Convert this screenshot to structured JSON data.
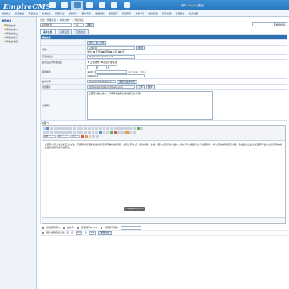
{
  "app": {
    "logo": "EmpireCMS",
    "top_icons": [
      "系统",
      "栏目",
      "信息",
      "模板",
      "用户",
      "其他",
      "插件"
    ],
    "active_top_icon": 2,
    "user_label": "用户:",
    "user_name": "admin",
    "logout": "[退出]"
  },
  "nav": [
    "增加信息",
    "管理信息",
    "审核信息",
    "签发信息",
    "管理评论",
    "更新碎片",
    "更新专题",
    "数据更新",
    "更新缓存",
    "管理附件",
    "发布字段",
    "类型管理",
    "标签管理",
    "远程发布",
    "站点地图"
  ],
  "sidebar": {
    "root": "管理信息",
    "items": [
      "导航分类",
      "导航分类一",
      "导航分类二",
      "导航分类三",
      "导航分类四"
    ]
  },
  "crumb": {
    "prefix": "位置：",
    "parts": [
      "管理信息",
      "导航分类一"
    ],
    "sep": " > ",
    "tail": "> 增加信息"
  },
  "toolbar": {
    "column_select": "请选择栏目",
    "rows_select": "一般",
    "go_button": "添加",
    "search_placeholder": "",
    "search_button": "搜索信息"
  },
  "tabs": [
    "基本信息",
    "选项设置",
    "设置信息"
  ],
  "form": {
    "header": "增加信息",
    "submit_label": "提交",
    "reset_label": "重置",
    "title_label": "标题(*)",
    "title_value": "标题名称",
    "check_btn": "检测",
    "attr_label": "属性",
    "attr_opts": [
      "置顶",
      "推荐",
      "头条",
      "幻灯"
    ],
    "source_label": "来源(链接)",
    "source_value": "http://www.phome.net/",
    "outlink_label": "是否直接为外部链接",
    "outlink_opts": [
      "正常发布",
      "直接外部链接"
    ],
    "sort_label": "特殊属性",
    "keywords_label": "关键字",
    "keywords_hint": "(多个请用\",\"隔开)",
    "titlepic_label": "外部链接",
    "pubtime_label": "发布时间",
    "pubtime_value": "2024-04-02 12:08:14",
    "settime_btn": "设置为当前时间",
    "pic_label": "标题图片",
    "pic_value": "/d/file/p/2024/04-02/titlepic.png",
    "upload_btn": "上传",
    "select_btn": "选择",
    "intro_label": "内容简介",
    "intro_value": "这里可以输入简介，不填写将截取内容前部分作为简介",
    "content_label": "内容(*)",
    "editor_fonts": [
      "格式",
      "字体",
      "大小"
    ],
    "content_text": "这里可以录入信息的正文内容。帝国网站管理系统提供所见即所得的编辑器，支持文字样式、段落排版、表格、图片以及附件的插入，用户可以像使用文字处理软件一样方便地编辑网页内容，完成后点击提交按钮即可发布信息到网站前台显示给所有访问者阅读。",
    "watermark": "msgshlog.com",
    "opt1": [
      "远程保存图片",
      "加水印",
      "远程保存FLASH",
      "远程保存其他"
    ],
    "opt2": [
      "图片缩略图设为第一张",
      "宽",
      "高",
      "保存内容"
    ],
    "opt2_value": "120"
  }
}
